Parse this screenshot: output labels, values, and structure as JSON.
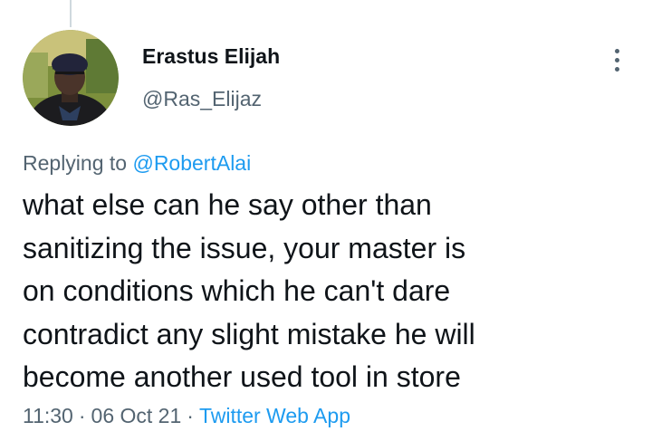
{
  "author": {
    "display_name": "Erastus Elijah",
    "handle": "@Ras_Elijaz",
    "avatar_icon": "profile-photo"
  },
  "more_icon": "more-vertical-icon",
  "reply": {
    "prefix": "Replying to",
    "mention": "@RobertAlai"
  },
  "tweet": {
    "lines": [
      "what else can he say other than",
      "sanitizing the issue, your master is",
      "on conditions which he can't dare",
      "contradict any slight mistake he will",
      "become another used tool in store"
    ]
  },
  "meta": {
    "time": "11:30",
    "separator": "·",
    "date": "06 Oct 21",
    "source": "Twitter Web App"
  },
  "colors": {
    "text": "#0f1419",
    "secondary": "#536471",
    "link": "#1d9bf0"
  }
}
